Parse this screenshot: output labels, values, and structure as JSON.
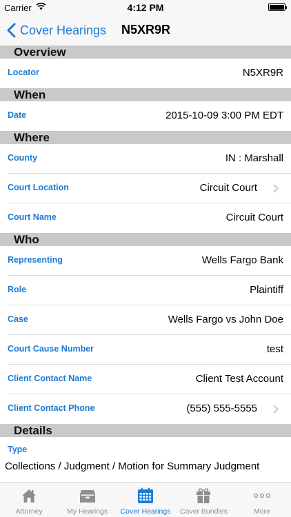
{
  "status_bar": {
    "carrier": "Carrier",
    "time": "4:12 PM",
    "battery_level": 1.0
  },
  "nav": {
    "back_label": "Cover Hearings",
    "title": "N5XR9R"
  },
  "sections": {
    "overview": {
      "header": "Overview",
      "locator_label": "Locator",
      "locator_value": "N5XR9R"
    },
    "when": {
      "header": "When",
      "date_label": "Date",
      "date_value": "2015-10-09 3:00 PM EDT"
    },
    "where": {
      "header": "Where",
      "county_label": "County",
      "county_value": "IN : Marshall",
      "court_location_label": "Court Location",
      "court_location_value": "Circuit Court",
      "court_name_label": "Court Name",
      "court_name_value": "Circuit Court"
    },
    "who": {
      "header": "Who",
      "representing_label": "Representing",
      "representing_value": "Wells Fargo Bank",
      "role_label": "Role",
      "role_value": "Plaintiff",
      "case_label": "Case",
      "case_value": "Wells Fargo vs John Doe",
      "cause_label": "Court Cause Number",
      "cause_value": "test",
      "contact_name_label": "Client Contact Name",
      "contact_name_value": "Client Test Account",
      "contact_phone_label": "Client Contact Phone",
      "contact_phone_value": "(555) 555-5555"
    },
    "details": {
      "header": "Details",
      "type_label": "Type",
      "type_value": "Collections / Judgment / Motion for Summary Judgment"
    }
  },
  "tabs": [
    {
      "label": "Attorney",
      "icon": "house-icon",
      "active": false
    },
    {
      "label": "My Hearings",
      "icon": "inbox-icon",
      "active": false
    },
    {
      "label": "Cover Hearings",
      "icon": "calendar-icon",
      "active": true
    },
    {
      "label": "Cover Bundles",
      "icon": "gift-icon",
      "active": false
    },
    {
      "label": "More",
      "icon": "more-icon",
      "active": false
    }
  ],
  "colors": {
    "accent": "#1a7bd6",
    "section_header_bg": "#c9c9c9",
    "bar_bg": "#f7f7f7",
    "inactive_tab": "#8e8e8e"
  }
}
